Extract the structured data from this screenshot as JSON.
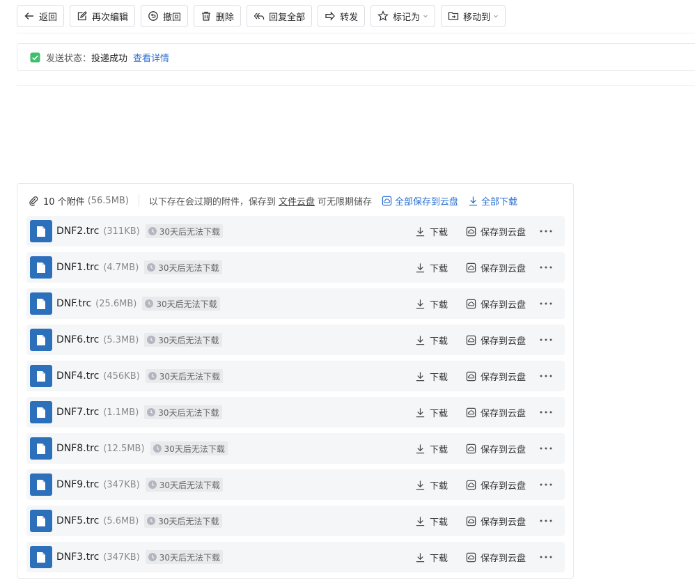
{
  "toolbar": {
    "back": "返回",
    "edit_again": "再次编辑",
    "recall": "撤回",
    "delete": "删除",
    "reply_all": "回复全部",
    "forward": "转发",
    "mark_as": "标记为",
    "move_to": "移动到"
  },
  "status": {
    "label": "发送状态：",
    "value": "投递成功",
    "link": "查看详情"
  },
  "attachments": {
    "count": "10 个附件",
    "total_size": "(56.5MB)",
    "note_prefix": "以下存在会过期的附件，保存到",
    "note_link": "文件云盘",
    "note_suffix": "可无限期储存",
    "save_all": "全部保存到云盘",
    "download_all": "全部下载",
    "download_label": "下载",
    "save_label": "保存到云盘",
    "expire_label": "30天后无法下载",
    "files": [
      {
        "name": "DNF2.trc",
        "size": "(311KB)"
      },
      {
        "name": "DNF1.trc",
        "size": "(4.7MB)"
      },
      {
        "name": "DNF.trc",
        "size": "(25.6MB)"
      },
      {
        "name": "DNF6.trc",
        "size": "(5.3MB)"
      },
      {
        "name": "DNF4.trc",
        "size": "(456KB)"
      },
      {
        "name": "DNF7.trc",
        "size": "(1.1MB)"
      },
      {
        "name": "DNF8.trc",
        "size": "(12.5MB)"
      },
      {
        "name": "DNF9.trc",
        "size": "(347KB)"
      },
      {
        "name": "DNF5.trc",
        "size": "(5.6MB)"
      },
      {
        "name": "DNF3.trc",
        "size": "(347KB)"
      }
    ]
  },
  "colors": {
    "accent": "#2a6fd1",
    "file_icon": "#2c6fbb",
    "success": "#3dbf6b"
  }
}
